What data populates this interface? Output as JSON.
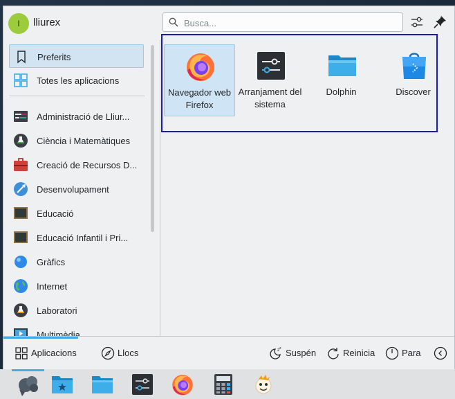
{
  "header": {
    "avatar_letter": "l",
    "username": "lliurex",
    "search_placeholder": "Busca...",
    "configure_icon": "configure-icon",
    "pin_icon": "pin-icon"
  },
  "sidebar": {
    "items": [
      {
        "label": "Preferits",
        "icon": "bookmark-icon",
        "selected": true
      },
      {
        "label": "Totes les aplicacions",
        "icon": "grid-apps-icon"
      },
      {
        "label": "Administració de Lliur...",
        "icon": "admin-icon"
      },
      {
        "label": "Ciència i Matemàtiques",
        "icon": "flask-icon"
      },
      {
        "label": "Creació de Recursos D...",
        "icon": "toolbox-icon"
      },
      {
        "label": "Desenvolupament",
        "icon": "development-icon"
      },
      {
        "label": "Educació",
        "icon": "chalkboard-icon"
      },
      {
        "label": "Educació Infantil i Pri...",
        "icon": "chalkboard-icon"
      },
      {
        "label": "Gràfics",
        "icon": "graphics-icon"
      },
      {
        "label": "Internet",
        "icon": "globe-icon"
      },
      {
        "label": "Laboratori",
        "icon": "lab-icon"
      },
      {
        "label": "Multimèdia",
        "icon": "multimedia-icon"
      }
    ]
  },
  "favorites": [
    {
      "label": "Navegador web Firefox",
      "icon": "firefox-icon",
      "selected": true
    },
    {
      "label": "Arranjament del sistema",
      "icon": "system-settings-icon"
    },
    {
      "label": "Dolphin",
      "icon": "folder-icon"
    },
    {
      "label": "Discover",
      "icon": "discover-icon"
    }
  ],
  "footer": {
    "applications": "Aplicacions",
    "places": "Llocs",
    "suspend": "Suspén",
    "restart": "Reinicia",
    "shutdown": "Para"
  },
  "taskbar": {
    "items": [
      "lliurex-launcher-icon",
      "favorites-folder-icon",
      "files-folder-icon",
      "system-settings-icon",
      "firefox-icon",
      "calculator-icon",
      "mascot-icon"
    ]
  },
  "colors": {
    "accent": "#3daee9",
    "selection_bg": "#d2e3f2",
    "focus_border": "#1a1ab5",
    "background": "#eff0f1"
  }
}
